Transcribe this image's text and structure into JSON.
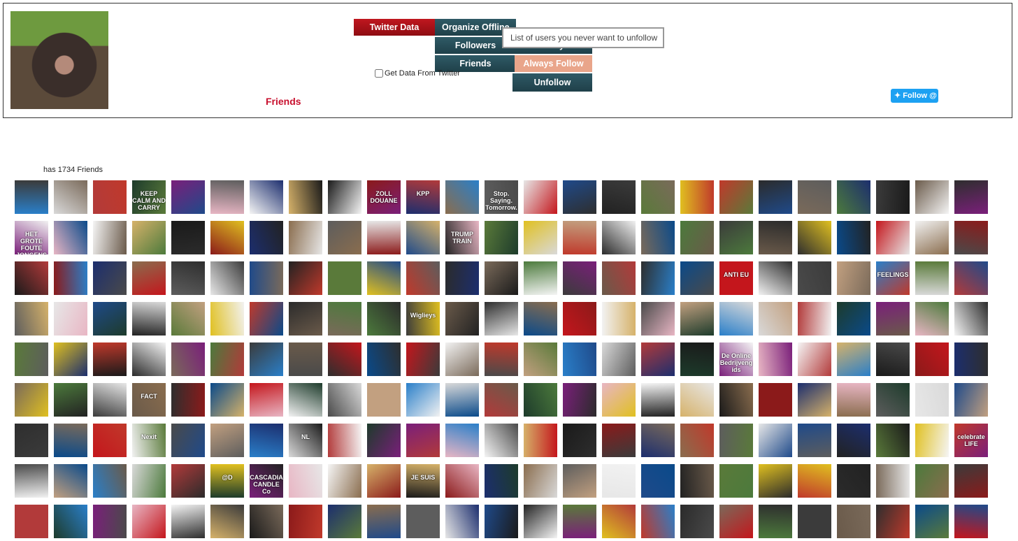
{
  "header": {
    "section_title": "Friends",
    "checkbox_label": "Get Data From Twitter",
    "follow_label": "Follow @",
    "tooltip": "List of users you never want to unfollow",
    "menu": {
      "twitter_data": "Twitter Data",
      "organize_offline": "Organize Offline",
      "followers": "Followers",
      "friends": "Friends",
      "always_follow": "Always Follow",
      "unfollow": "Unfollow",
      "always_partial": "Always"
    }
  },
  "friends": {
    "count_text": "has 1734 Friends",
    "columns": 25,
    "rows": 9,
    "avatar_labels": {
      "3": "KEEP CALM AND CARRY",
      "9": "ZOLL DOUANE",
      "10": "KPP",
      "12": "Stop. Saying. Tomorrow.",
      "25": "HET GROTE FOUTE JONGENS BOEK",
      "36": "TRUMP TRAIN",
      "68": "ANTI EU",
      "72": "FEELINGS",
      "85": "Wiglieys",
      "118": "De Online Bedrijvengids",
      "128": "FACT",
      "153": "Nexit",
      "157": "NL",
      "174": "celebrate LIFE",
      "180": "@D",
      "181": "CASCADIA CANDLE Co",
      "185": "JE SUIS"
    },
    "palette": [
      "#2a7fc9",
      "#e7e7e7",
      "#c4161c",
      "#8b1a1a",
      "#3b3b3b",
      "#e8b6c4",
      "#c0392b",
      "#d9d9d9",
      "#1f4a8a",
      "#f2f2f2",
      "#1c2e6e",
      "#6a5a4a",
      "#f5f5f5",
      "#2b2b2b",
      "#b23a3a",
      "#222222",
      "#4a4a4a",
      "#8a6d4e",
      "#2e2e2e",
      "#d6b26a",
      "#7a6a5a",
      "#1d3b2b",
      "#5a7a3a",
      "#c2a080",
      "#5d5d5d",
      "#0a4a8a",
      "#1a1a1a",
      "#4c7a3c",
      "#7a1f7a",
      "#e0c020"
    ]
  }
}
